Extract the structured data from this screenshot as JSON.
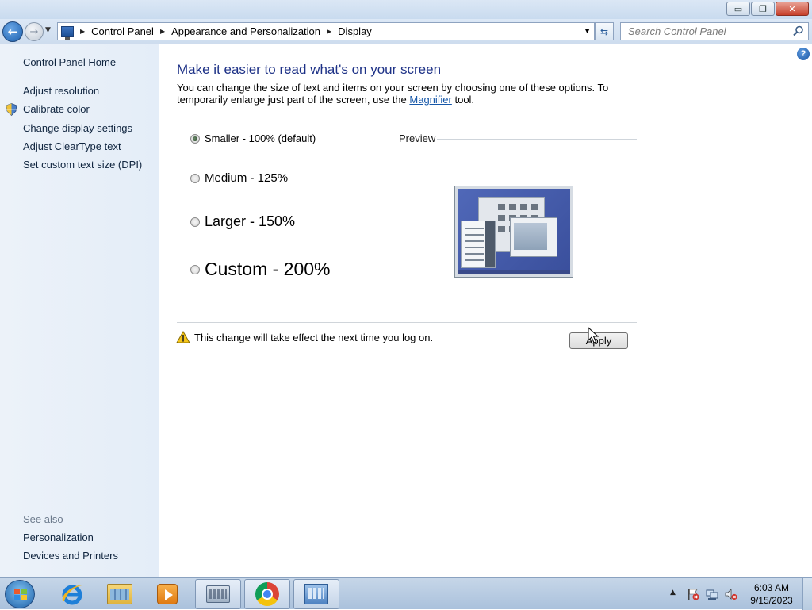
{
  "window": {
    "controls": {
      "minimize": "▭",
      "maximize": "❐",
      "close": "✕"
    }
  },
  "address_bar": {
    "breadcrumbs": [
      "Control Panel",
      "Appearance and Personalization",
      "Display"
    ],
    "search_placeholder": "Search Control Panel"
  },
  "sidebar": {
    "home_label": "Control Panel Home",
    "items": [
      {
        "label": "Adjust resolution",
        "icon": ""
      },
      {
        "label": "Calibrate color",
        "icon": "shield-icon"
      },
      {
        "label": "Change display settings",
        "icon": ""
      },
      {
        "label": "Adjust ClearType text",
        "icon": ""
      },
      {
        "label": "Set custom text size (DPI)",
        "icon": ""
      }
    ],
    "see_also_label": "See also",
    "see_also": [
      "Personalization",
      "Devices and Printers"
    ]
  },
  "main": {
    "heading": "Make it easier to read what's on your screen",
    "description_before": "You can change the size of text and items on your screen by choosing one of these options. To temporarily enlarge just part of the screen, use the ",
    "magnifier_link": "Magnifier",
    "description_after": " tool.",
    "options": [
      {
        "label": "Smaller - 100% (default)",
        "checked": true
      },
      {
        "label": "Medium - 125%",
        "checked": false
      },
      {
        "label": "Larger - 150%",
        "checked": false
      },
      {
        "label": "Custom - 200%",
        "checked": false
      }
    ],
    "preview_label": "Preview",
    "warning_text": "This change will take effect the next time you log on.",
    "apply_label": "Apply"
  },
  "taskbar": {
    "pinned": [
      "internet-explorer-icon",
      "file-explorer-icon",
      "media-player-icon",
      "keyboard-icon",
      "chrome-icon",
      "control-panel-icon"
    ],
    "tray_icons": [
      "action-center-flag-icon",
      "network-icon",
      "volume-muted-icon"
    ],
    "time": "6:03 AM",
    "date": "9/15/2023"
  },
  "colors": {
    "heading": "#1e3287",
    "link": "#1657a8",
    "sidebar_bg": "#e4edf8"
  }
}
